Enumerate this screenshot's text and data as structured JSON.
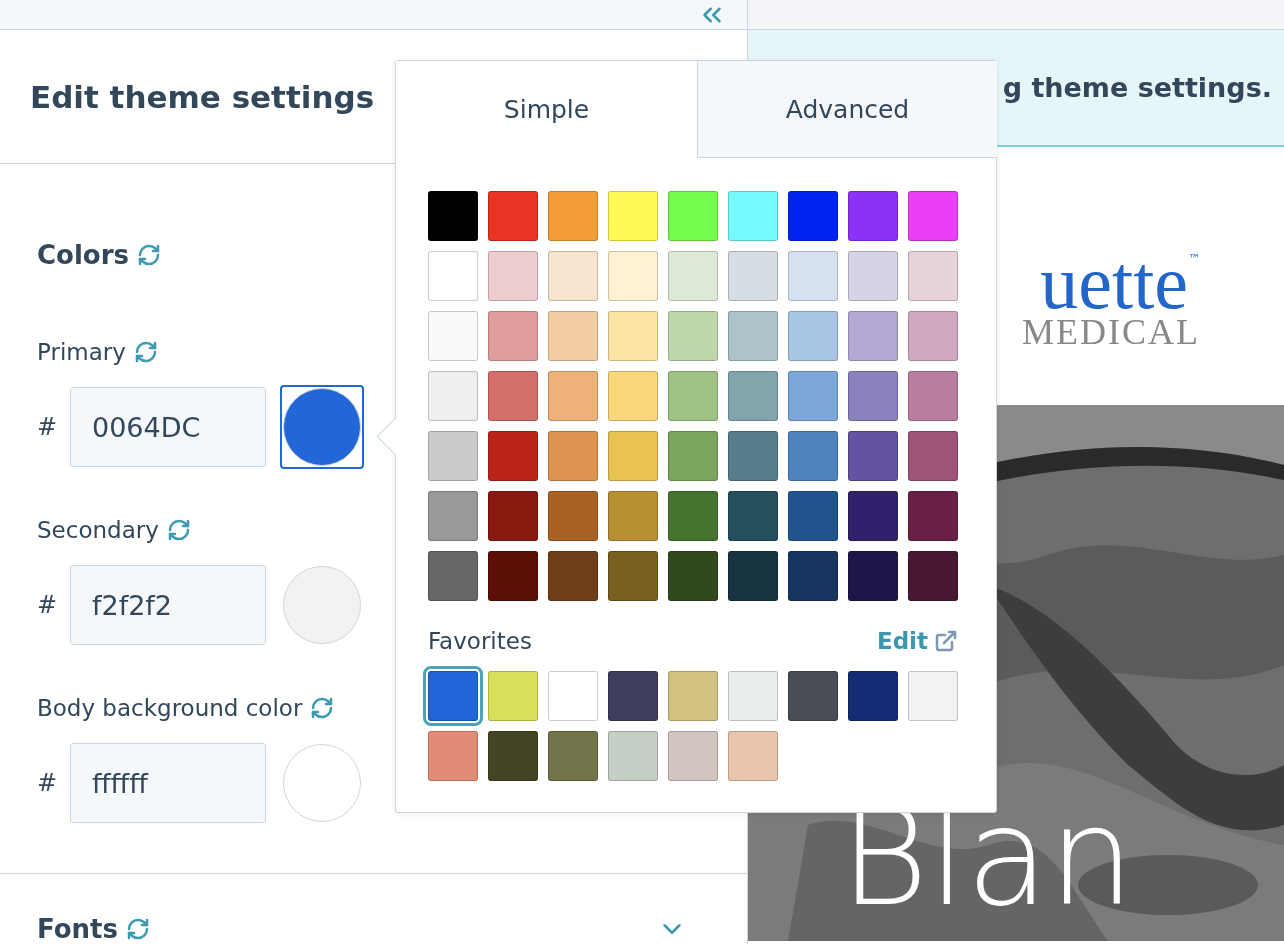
{
  "panel": {
    "title": "Edit theme settings",
    "sections": [
      {
        "title": "Colors",
        "fields": [
          {
            "label": "Primary",
            "prefix": "#",
            "value": "0064DC",
            "color": "#2266d8",
            "selected": true
          },
          {
            "label": "Secondary",
            "prefix": "#",
            "value": "f2f2f2",
            "color": "#f2f2f2",
            "selected": false
          },
          {
            "label": "Body background color",
            "prefix": "#",
            "value": "ffffff",
            "color": "#ffffff",
            "selected": false
          }
        ]
      },
      {
        "title": "Fonts"
      }
    ]
  },
  "picker": {
    "tabs": [
      {
        "label": "Simple",
        "selected": true
      },
      {
        "label": "Advanced",
        "selected": false
      }
    ],
    "palette": [
      [
        {
          "color": "#000000",
          "selected": false
        },
        {
          "color": "#e93323",
          "selected": false
        },
        {
          "color": "#f29d38",
          "selected": false
        },
        {
          "color": "#fffb54",
          "selected": false
        },
        {
          "color": "#75fb4c",
          "selected": false
        },
        {
          "color": "#75fbfd",
          "selected": false
        },
        {
          "color": "#0023f5",
          "selected": false
        },
        {
          "color": "#8c31f5",
          "selected": false
        },
        {
          "color": "#ea3ff7",
          "selected": false
        }
      ],
      [
        {
          "color": "#ffffff",
          "selected": false
        },
        {
          "color": "#eecdd0",
          "selected": false
        },
        {
          "color": "#f8e5d0",
          "selected": false
        },
        {
          "color": "#fef2d0",
          "selected": false
        },
        {
          "color": "#dde8d6",
          "selected": false
        },
        {
          "color": "#d4dee3",
          "selected": false
        },
        {
          "color": "#d5e1f1",
          "selected": false
        },
        {
          "color": "#d8d2e7",
          "selected": false
        },
        {
          "color": "#e8d2db",
          "selected": false
        }
      ],
      [
        {
          "color": "#fafafa",
          "selected": false
        },
        {
          "color": "#df9d9b",
          "selected": false
        },
        {
          "color": "#f3cca1",
          "selected": false
        },
        {
          "color": "#fce4a2",
          "selected": false
        },
        {
          "color": "#bfd6ab",
          "selected": false
        },
        {
          "color": "#abc3c9",
          "selected": false
        },
        {
          "color": "#a8c5e6",
          "selected": false
        },
        {
          "color": "#b3a8d3",
          "selected": false
        },
        {
          "color": "#d0a8bf",
          "selected": false
        }
      ],
      [
        {
          "color": "#efefef",
          "selected": false
        },
        {
          "color": "#d36f69",
          "selected": false
        },
        {
          "color": "#eeb278",
          "selected": false
        },
        {
          "color": "#f9d77a",
          "selected": false
        },
        {
          "color": "#9fc384",
          "selected": false
        },
        {
          "color": "#81a4ad",
          "selected": false
        },
        {
          "color": "#7ca6d8",
          "selected": false
        },
        {
          "color": "#8b7fbd",
          "selected": false
        },
        {
          "color": "#b97e9e",
          "selected": false
        }
      ],
      [
        {
          "color": "#cbcbcb",
          "selected": false
        },
        {
          "color": "#ba2419",
          "selected": false
        },
        {
          "color": "#dd9450",
          "selected": false
        },
        {
          "color": "#eac254",
          "selected": false
        },
        {
          "color": "#79a55c",
          "selected": false
        },
        {
          "color": "#567f8b",
          "selected": false
        },
        {
          "color": "#4f83c0",
          "selected": false
        },
        {
          "color": "#6453a1",
          "selected": false
        },
        {
          "color": "#9c5477",
          "selected": false
        }
      ],
      [
        {
          "color": "#999999",
          "selected": false
        },
        {
          "color": "#8a1a10",
          "selected": false
        },
        {
          "color": "#a96225",
          "selected": false
        },
        {
          "color": "#b88f33",
          "selected": false
        },
        {
          "color": "#477331",
          "selected": false
        },
        {
          "color": "#244f5d",
          "selected": false
        },
        {
          "color": "#21548e",
          "selected": false
        },
        {
          "color": "#31216c",
          "selected": false
        },
        {
          "color": "#6a2045",
          "selected": false
        }
      ],
      [
        {
          "color": "#666666",
          "selected": false
        },
        {
          "color": "#5c0f07",
          "selected": false
        },
        {
          "color": "#6e3f17",
          "selected": false
        },
        {
          "color": "#7a601f",
          "selected": false
        },
        {
          "color": "#2f4a1c",
          "selected": false
        },
        {
          "color": "#173440",
          "selected": false
        },
        {
          "color": "#163660",
          "selected": false
        },
        {
          "color": "#1d1749",
          "selected": false
        },
        {
          "color": "#481830",
          "selected": false
        }
      ]
    ],
    "favorites": {
      "title": "Favorites",
      "link": "Edit",
      "swatches": [
        {
          "color": "#2265d8",
          "selected": true
        },
        {
          "color": "#d8df58",
          "selected": false
        },
        {
          "color": "#ffffff",
          "selected": false
        },
        {
          "color": "#3e3f5c",
          "selected": false
        },
        {
          "color": "#d1c282",
          "selected": false
        },
        {
          "color": "#eaefeb",
          "selected": false
        },
        {
          "color": "#494d56",
          "selected": false
        },
        {
          "color": "#132e74",
          "selected": false
        },
        {
          "color": "#f2f2f2",
          "selected": false
        },
        {
          "color": "#e18c76",
          "selected": false
        },
        {
          "color": "#444524",
          "selected": false
        },
        {
          "color": "#74744a",
          "selected": false
        },
        {
          "color": "#c5cfc6",
          "selected": false
        },
        {
          "color": "#d3c5c0",
          "selected": false
        },
        {
          "color": "#e9c5ac",
          "selected": false
        }
      ]
    }
  },
  "preview": {
    "banner": "g theme settings.",
    "logo": {
      "name": "uette",
      "mark": "™",
      "tagline": "MEDICAL"
    },
    "hero": {
      "kind": "picture",
      "heading": "Blan"
    }
  }
}
